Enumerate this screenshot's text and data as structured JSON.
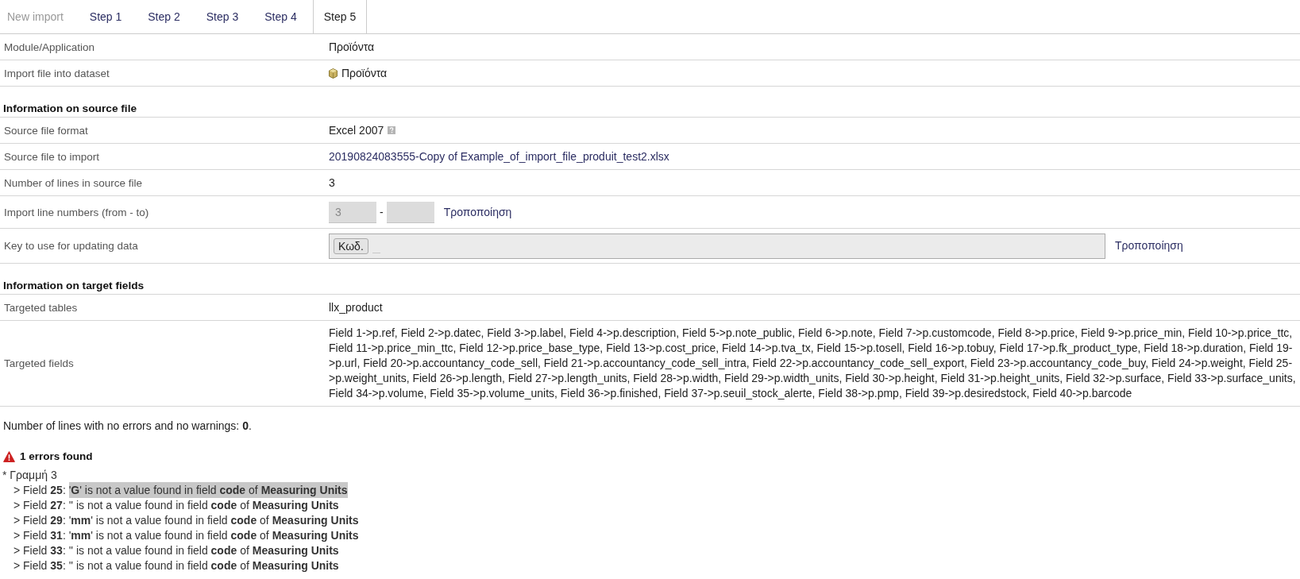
{
  "tabs": [
    {
      "label": "New import",
      "selected": false,
      "disabled": true
    },
    {
      "label": "Step 1",
      "selected": false,
      "disabled": false
    },
    {
      "label": "Step 2",
      "selected": false,
      "disabled": false
    },
    {
      "label": "Step 3",
      "selected": false,
      "disabled": false
    },
    {
      "label": "Step 4",
      "selected": false,
      "disabled": false
    },
    {
      "label": "Step 5",
      "selected": true,
      "disabled": false
    }
  ],
  "general": {
    "rows": [
      {
        "kind": "text",
        "label": "Module/Application",
        "value": "Προϊόντα"
      },
      {
        "kind": "dataset",
        "label": "Import file into dataset",
        "value": "Προϊόντα"
      }
    ]
  },
  "source_file": {
    "heading": "Information on source file",
    "rows": [
      {
        "kind": "help",
        "label": "Source file format",
        "value": "Excel 2007"
      },
      {
        "kind": "link",
        "label": "Source file to import",
        "value": "20190824083555-Copy of Example_of_import_file_produit_test2.xlsx"
      },
      {
        "kind": "text",
        "label": "Number of lines in source file",
        "value": "3"
      },
      {
        "kind": "range",
        "label": "Import line numbers (from - to)",
        "from": "3",
        "separator": "-",
        "disabled": true,
        "link": "Τροποποίηση"
      },
      {
        "kind": "key",
        "label": "Key to use for updating data",
        "tags": [
          "Κωδ."
        ],
        "link": "Τροποποίηση"
      }
    ]
  },
  "target_fields": {
    "heading": "Information on target fields",
    "rows": [
      {
        "kind": "text",
        "label": "Targeted tables",
        "value": "llx_product"
      },
      {
        "kind": "text",
        "label": "Targeted fields",
        "value": "Field 1->p.ref, Field 2->p.datec, Field 3->p.label, Field 4->p.description, Field 5->p.note_public, Field 6->p.note, Field 7->p.customcode, Field 8->p.price, Field 9->p.price_min, Field 10->p.price_ttc, Field 11->p.price_min_ttc, Field 12->p.price_base_type, Field 13->p.cost_price, Field 14->p.tva_tx, Field 15->p.tosell, Field 16->p.tobuy, Field 17->p.fk_product_type, Field 18->p.duration, Field 19->p.url, Field 20->p.accountancy_code_sell, Field 21->p.accountancy_code_sell_intra, Field 22->p.accountancy_code_sell_export, Field 23->p.accountancy_code_buy, Field 24->p.weight, Field 25->p.weight_units, Field 26->p.length, Field 27->p.length_units, Field 28->p.width, Field 29->p.width_units, Field 30->p.height, Field 31->p.height_units, Field 32->p.surface, Field 33->p.surface_units, Field 34->p.volume, Field 35->p.volume_units, Field 36->p.finished, Field 37->p.seuil_stock_alerte, Field 38->p.pmp, Field 39->p.desiredstock, Field 40->p.barcode"
      }
    ]
  },
  "summary": "Number of lines with no errors and no warnings: **0**.",
  "errors": {
    "title": "1 errors found",
    "line": "* Γραμμή 3",
    "items": [
      {
        "field": "> Field **25**:",
        "message": "'**G**' is not a value found in field **code** of **Measuring Units**",
        "highlighted": true
      },
      {
        "field": "> Field **27**:",
        "message": "'' is not a value found in field **code** of **Measuring Units**",
        "highlighted": false
      },
      {
        "field": "> Field **29**:",
        "message": "'**mm**' is not a value found in field **code** of **Measuring Units**",
        "highlighted": false
      },
      {
        "field": "> Field **31**:",
        "message": "'**mm**' is not a value found in field **code** of **Measuring Units**",
        "highlighted": false
      },
      {
        "field": "> Field **33**:",
        "message": "'' is not a value found in field **code** of **Measuring Units**",
        "highlighted": false
      },
      {
        "field": "> Field **35**:",
        "message": "'' is not a value found in field **code** of **Measuring Units**",
        "highlighted": false
      }
    ]
  }
}
